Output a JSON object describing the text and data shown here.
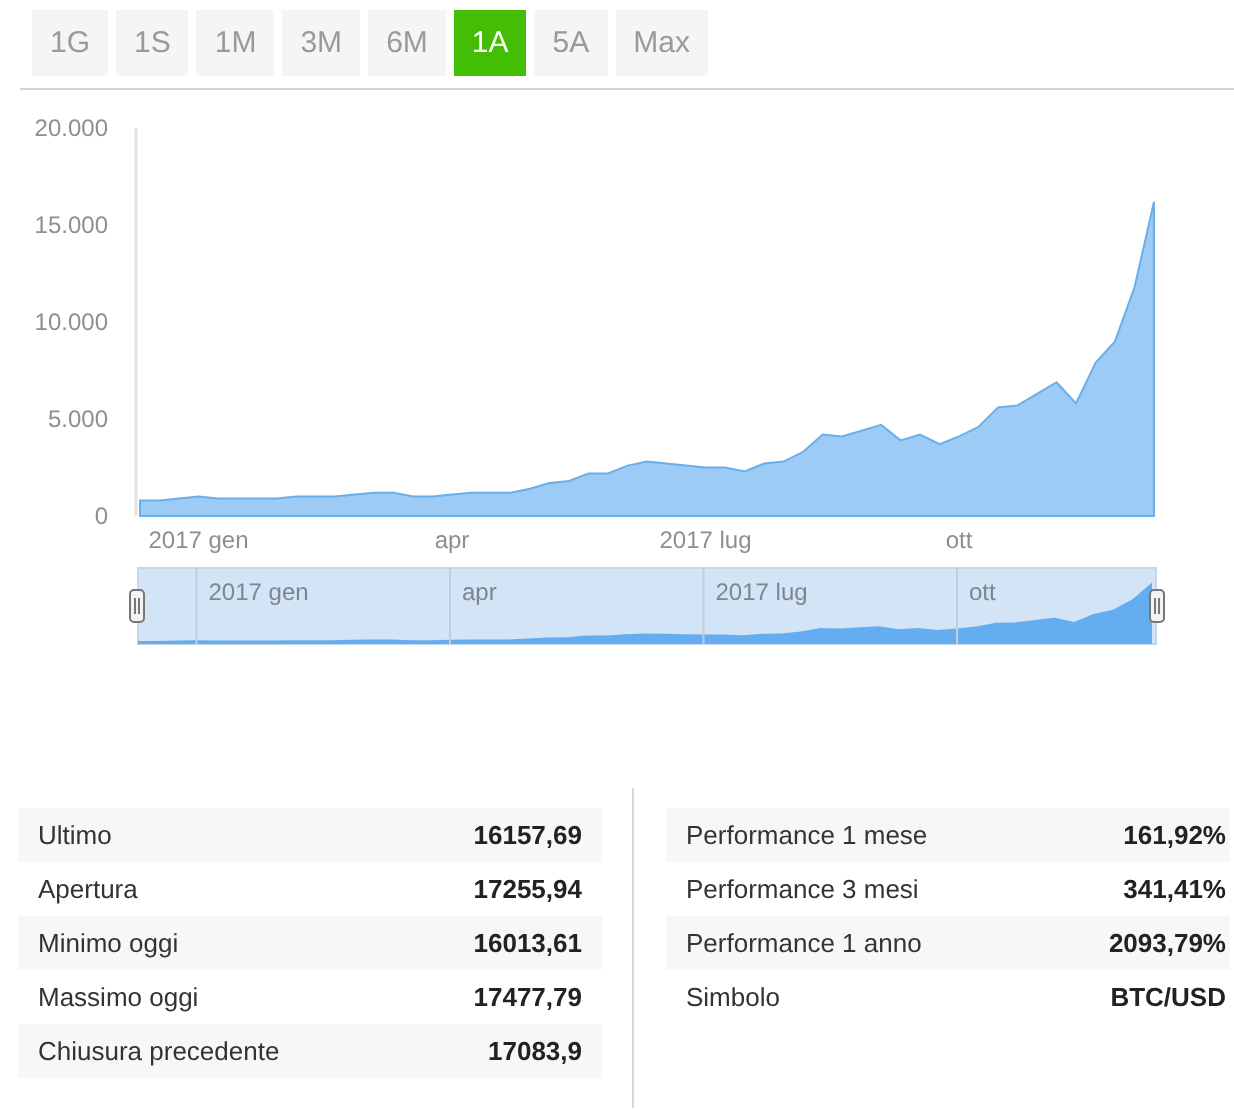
{
  "periods": [
    {
      "label": "1G",
      "selected": false
    },
    {
      "label": "1S",
      "selected": false
    },
    {
      "label": "1M",
      "selected": false
    },
    {
      "label": "3M",
      "selected": false
    },
    {
      "label": "6M",
      "selected": false
    },
    {
      "label": "1A",
      "selected": true
    },
    {
      "label": "5A",
      "selected": false
    },
    {
      "label": "Max",
      "selected": false
    }
  ],
  "chart": {
    "chart_data": {
      "type": "area",
      "ylim": [
        0,
        20000
      ],
      "categories": [
        null,
        null,
        null,
        "2017 gen",
        null,
        null,
        null,
        null,
        null,
        null,
        null,
        null,
        null,
        null,
        null,
        null,
        "apr",
        null,
        null,
        null,
        null,
        null,
        null,
        null,
        null,
        null,
        null,
        null,
        null,
        "2017 lug",
        null,
        null,
        null,
        null,
        null,
        null,
        null,
        null,
        null,
        null,
        null,
        null,
        "ott",
        null,
        null,
        null,
        null,
        null,
        null,
        null,
        null,
        null,
        null
      ],
      "series": [
        {
          "color": "#9ccbf5",
          "values": [
            800,
            800,
            900,
            1000,
            900,
            900,
            900,
            900,
            1000,
            1000,
            1000,
            1100,
            1200,
            1200,
            1000,
            1000,
            1100,
            1200,
            1200,
            1200,
            1400,
            1700,
            1800,
            2200,
            2200,
            2600,
            2800,
            2700,
            2600,
            2500,
            2500,
            2300,
            2700,
            2800,
            3300,
            4200,
            4100,
            4400,
            4700,
            3900,
            4200,
            3700,
            4100,
            4600,
            5600,
            5700,
            6300,
            6900,
            5800,
            7900,
            9000,
            11800,
            16200
          ]
        }
      ],
      "yticks": [
        {
          "value": 0,
          "label": "0"
        },
        {
          "value": 5000,
          "label": "5.000"
        },
        {
          "value": 10000,
          "label": "10.000"
        },
        {
          "value": 15000,
          "label": "15.000"
        },
        {
          "value": 20000,
          "label": "20.000"
        }
      ]
    }
  },
  "navigator": {
    "labels": [
      "2017 gen",
      "apr",
      "2017 lug",
      "ott"
    ]
  },
  "stats_left": [
    {
      "label": "Ultimo",
      "value": "16157,69"
    },
    {
      "label": "Apertura",
      "value": "17255,94"
    },
    {
      "label": "Minimo oggi",
      "value": "16013,61"
    },
    {
      "label": "Massimo oggi",
      "value": "17477,79"
    },
    {
      "label": "Chiusura precedente",
      "value": "17083,9"
    }
  ],
  "stats_right": [
    {
      "label": "Performance 1 mese",
      "value": "161,92%"
    },
    {
      "label": "Performance 3 mesi",
      "value": "341,41%"
    },
    {
      "label": "Performance 1 anno",
      "value": "2093,79%"
    },
    {
      "label": "Simbolo",
      "value": "BTC/USD"
    }
  ]
}
